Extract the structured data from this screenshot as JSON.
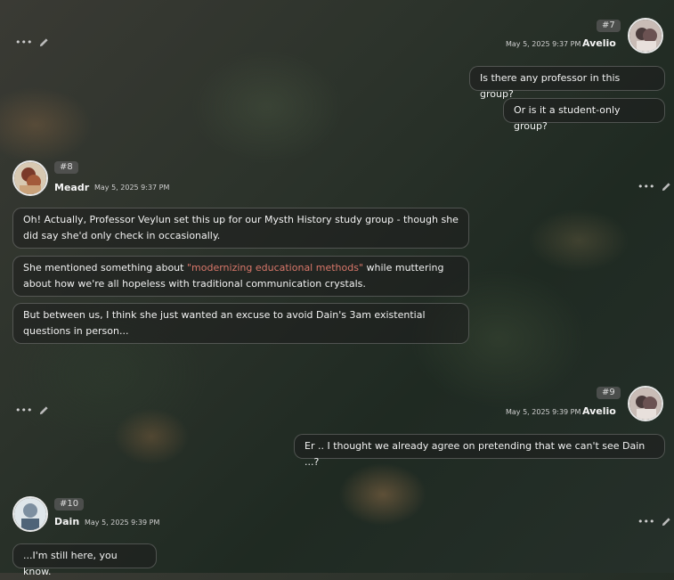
{
  "messages": [
    {
      "number": "#7",
      "author": "Avelio",
      "timestamp": "May 5, 2025 9:37 PM",
      "lines": [
        "Is there any professor in this group?",
        "Or is it a student-only group?"
      ]
    },
    {
      "number": "#8",
      "author": "Meadr",
      "timestamp": "May 5, 2025 9:37 PM",
      "lines": [
        "Oh! Actually, Professor Veylun set this up for our Mysth History study group - though she did say she'd only check in occasionally.",
        {
          "before": "She mentioned something about ",
          "highlight": "\"modernizing educational methods\"",
          "after": " while muttering about how we're all hopeless with traditional communication crystals."
        },
        "But between us, I think she just wanted an excuse to avoid Dain's 3am existential questions in person..."
      ]
    },
    {
      "number": "#9",
      "author": "Avelio",
      "timestamp": "May 5, 2025 9:39 PM",
      "lines": [
        "Er .. I thought we already agree on pretending that we can't see Dain ...?"
      ]
    },
    {
      "number": "#10",
      "author": "Dain",
      "timestamp": "May 5, 2025 9:39 PM",
      "lines": [
        "...I'm still here, you know."
      ]
    }
  ],
  "icons": {
    "more": "more-dots-icon",
    "edit": "pencil-icon"
  },
  "colors": {
    "highlight": "#d9776a"
  }
}
